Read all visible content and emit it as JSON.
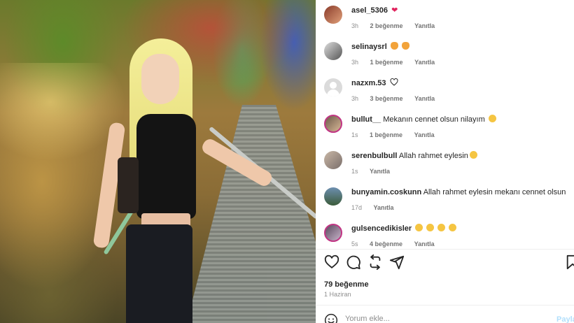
{
  "comments": [
    {
      "username": "asel_5306",
      "text": "",
      "emoji": "heart",
      "time": "3h",
      "likes": "2 beğenme",
      "reply": "Yanıtla",
      "avatar": "photo-avatar"
    },
    {
      "username": "selinaysrl",
      "text": "",
      "emoji": "cats",
      "time": "3h",
      "likes": "1 beğenme",
      "reply": "Yanıtla",
      "avatar": "photo-avatar"
    },
    {
      "username": "nazxm.53",
      "text": "",
      "emoji": "outline-heart",
      "time": "3h",
      "likes": "3 beğenme",
      "reply": "Yanıtla",
      "avatar": "default-avatar"
    },
    {
      "username": "bullut__",
      "text": "Mekanın cennet olsun nilayım",
      "emoji": "sad",
      "time": "1s",
      "likes": "1 beğenme",
      "reply": "Yanıtla",
      "avatar": "story-ring-avatar"
    },
    {
      "username": "serenbulbull",
      "text": "Allah rahmet eylesin",
      "emoji": "sad",
      "time": "1s",
      "likes": "",
      "reply": "Yanıtla",
      "avatar": "photo-avatar"
    },
    {
      "username": "bunyamin.coskunn",
      "text": "Allah rahmet eylesin mekanı cennet olsun",
      "emoji": "",
      "time": "17d",
      "likes": "",
      "reply": "Yanıtla",
      "avatar": "photo-avatar"
    },
    {
      "username": "gulsencedikisler",
      "text": "",
      "emoji": "sad-x4",
      "time": "5s",
      "likes": "4 beğenme",
      "reply": "Yanıtla",
      "avatar": "story-ring-avatar"
    }
  ],
  "post": {
    "likes_total": "79 beğenme",
    "date": "1 Haziran"
  },
  "add_comment": {
    "placeholder": "Yorum ekle...",
    "post_label": "Payla"
  },
  "icons": {
    "like": "heart-icon",
    "comment": "comment-icon",
    "share": "repost-icon",
    "send": "send-icon",
    "save": "bookmark-icon",
    "emoji": "smiley-icon"
  },
  "colors": {
    "story_ring": "#c13584",
    "heart_red": "#e0245e",
    "muted": "#8e8e8e",
    "post_disabled": "#b2dffc"
  }
}
